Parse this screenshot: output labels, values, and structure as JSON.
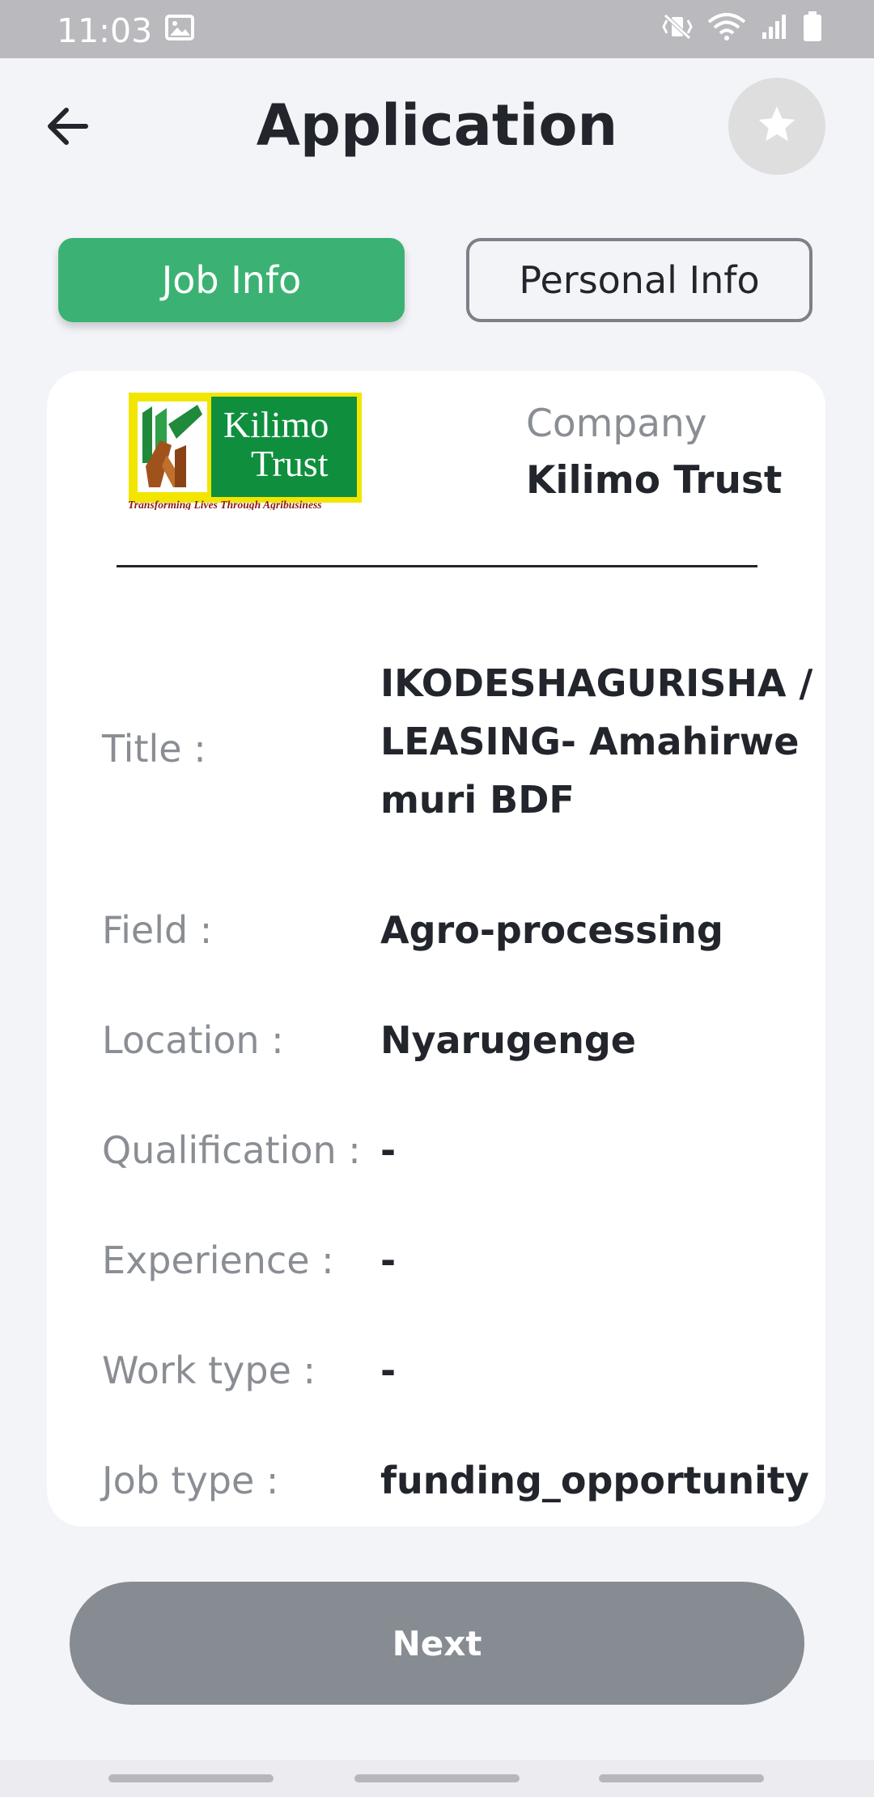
{
  "status": {
    "time": "11:03"
  },
  "header": {
    "title": "Application",
    "back_icon": "arrow-left-icon",
    "favorite_icon": "star-icon"
  },
  "tabs": [
    {
      "label": "Job Info",
      "active": true
    },
    {
      "label": "Personal Info",
      "active": false
    }
  ],
  "company": {
    "label": "Company",
    "name": "Kilimo Trust",
    "logo": {
      "line1": "Kilimo",
      "line2": "Trust",
      "tagline": "Transforming Lives Through Agribusiness"
    }
  },
  "details": [
    {
      "label": "Title :",
      "value": "IKODESHAGURISHA / LEASING- Amahirwe muri BDF"
    },
    {
      "label": "Field :",
      "value": "Agro-processing"
    },
    {
      "label": "Location :",
      "value": "Nyarugenge"
    },
    {
      "label": "Qualification :",
      "value": "-"
    },
    {
      "label": "Experience :",
      "value": "-"
    },
    {
      "label": "Work type :",
      "value": "-"
    },
    {
      "label": "Job type :",
      "value": "funding_opportunity"
    }
  ],
  "actions": {
    "next_label": "Next"
  },
  "colors": {
    "accent": "#3bb273",
    "button_disabled": "#878c93",
    "background": "#f3f4f8"
  }
}
